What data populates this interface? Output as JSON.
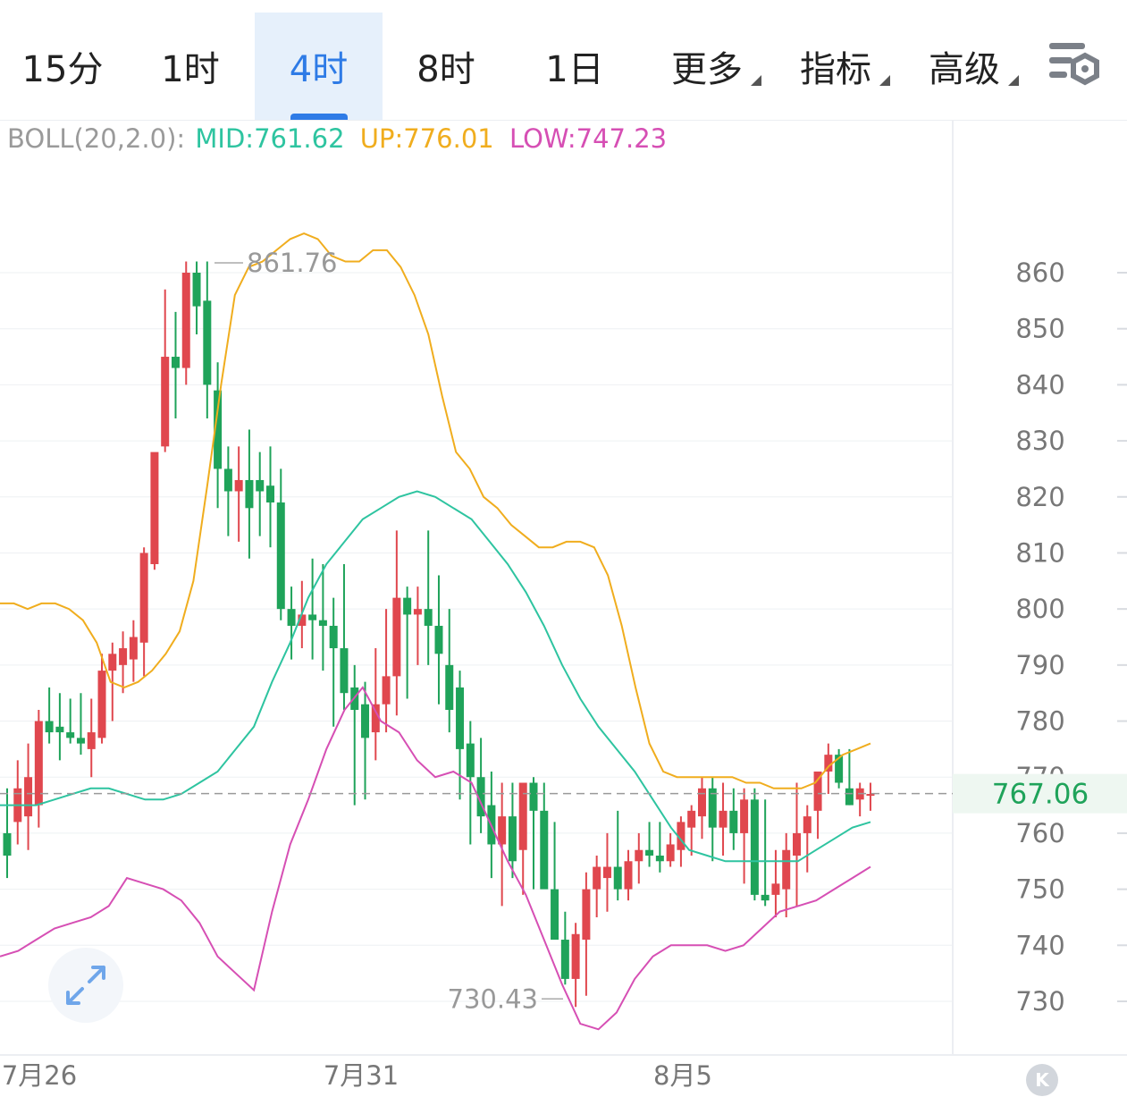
{
  "tabs": [
    {
      "label": "15分",
      "active": false,
      "dropdown": false
    },
    {
      "label": "1时",
      "active": false,
      "dropdown": false
    },
    {
      "label": "4时",
      "active": true,
      "dropdown": false
    },
    {
      "label": "8时",
      "active": false,
      "dropdown": false
    },
    {
      "label": "1日",
      "active": false,
      "dropdown": false
    },
    {
      "label": "更多",
      "active": false,
      "dropdown": true
    },
    {
      "label": "指标",
      "active": false,
      "dropdown": true
    },
    {
      "label": "高级",
      "active": false,
      "dropdown": true
    }
  ],
  "settings_icon": "chart-settings-icon",
  "expand_icon": "expand-arrows-icon",
  "scroll_end_icon": "k-icon",
  "scroll_end_label": "K",
  "indicator": {
    "name": "BOLL(20,2.0):",
    "mid": "MID:761.62",
    "up": "UP:776.01",
    "low": "LOW:747.23",
    "colors": {
      "name": "#9a9a9a",
      "mid": "#2ec4a0",
      "up": "#f0ad1e",
      "low": "#d64fb4"
    }
  },
  "chart_data": {
    "type": "candlestick",
    "interval": "4时",
    "ylim": [
      723,
      875
    ],
    "yticks": [
      730,
      740,
      750,
      760,
      770,
      780,
      790,
      800,
      810,
      820,
      830,
      840,
      850,
      860
    ],
    "ytick_labels": [
      "730",
      "740",
      "750",
      "760",
      "770",
      "780",
      "790",
      "800",
      "810",
      "820",
      "830",
      "840",
      "850",
      "860"
    ],
    "xtick_labels": [
      "7月26",
      "7月31",
      "8月5"
    ],
    "current_price": 767.06,
    "current_price_label": "767.06",
    "high_annotation": {
      "value": 861.76,
      "label": "861.76"
    },
    "low_annotation": {
      "value": 730.43,
      "label": "730.43"
    },
    "colors": {
      "up": "#e0474e",
      "down": "#1fa35a",
      "boll_up": "#f0ad1e",
      "boll_mid": "#2ec4a0",
      "boll_low": "#d64fb4",
      "grid": "#eef0f3",
      "axis_text": "#777777",
      "current_price": "#1fa35a"
    },
    "candles": [
      [
        760,
        768,
        752,
        756
      ],
      [
        762,
        773,
        758,
        768
      ],
      [
        763,
        776,
        757,
        770
      ],
      [
        765,
        782,
        761,
        780
      ],
      [
        780,
        786,
        776,
        778
      ],
      [
        779,
        785,
        773,
        778
      ],
      [
        778,
        784,
        776,
        777
      ],
      [
        777,
        785,
        774,
        776
      ],
      [
        775,
        784,
        770,
        778
      ],
      [
        777,
        792,
        776,
        789
      ],
      [
        789,
        794,
        780,
        792
      ],
      [
        790,
        796,
        785,
        793
      ],
      [
        791,
        798,
        787,
        795
      ],
      [
        794,
        811,
        788,
        810
      ],
      [
        808,
        826,
        807,
        828
      ],
      [
        829,
        857,
        828,
        845
      ],
      [
        845,
        853,
        834,
        843
      ],
      [
        843,
        862,
        840,
        860
      ],
      [
        860,
        862,
        849,
        854
      ],
      [
        855,
        862,
        834,
        840
      ],
      [
        839,
        844,
        818,
        825
      ],
      [
        825,
        829,
        813,
        821
      ],
      [
        821,
        829,
        812,
        823
      ],
      [
        823,
        832,
        809,
        818
      ],
      [
        823,
        828,
        813,
        821
      ],
      [
        822,
        829,
        811,
        819
      ],
      [
        819,
        825,
        798,
        800
      ],
      [
        800,
        804,
        791,
        797
      ],
      [
        797,
        805,
        793,
        799
      ],
      [
        799,
        809,
        791,
        798
      ],
      [
        798,
        808,
        789,
        797
      ],
      [
        797,
        802,
        779,
        793
      ],
      [
        793,
        808,
        782,
        785
      ],
      [
        786,
        790,
        765,
        782
      ],
      [
        783,
        787,
        766,
        777
      ],
      [
        778,
        793,
        773,
        783
      ],
      [
        783,
        800,
        778,
        788
      ],
      [
        788,
        814,
        781,
        802
      ],
      [
        802,
        804,
        784,
        799
      ],
      [
        799,
        804,
        790,
        800
      ],
      [
        800,
        814,
        790,
        797
      ],
      [
        797,
        806,
        783,
        792
      ],
      [
        790,
        800,
        778,
        782
      ],
      [
        786,
        789,
        766,
        775
      ],
      [
        776,
        780,
        758,
        770
      ],
      [
        770,
        777,
        760,
        763
      ],
      [
        765,
        771,
        752,
        758
      ],
      [
        758,
        769,
        747,
        763
      ],
      [
        763,
        769,
        752,
        755
      ],
      [
        757,
        769,
        749,
        769
      ],
      [
        769,
        770,
        750,
        764
      ],
      [
        764,
        769,
        752,
        750
      ],
      [
        750,
        762,
        742,
        741
      ],
      [
        741,
        746,
        733,
        734
      ],
      [
        734,
        744,
        729,
        742
      ],
      [
        741,
        753,
        731,
        750
      ],
      [
        750,
        756,
        745,
        754
      ],
      [
        752,
        760,
        746,
        754
      ],
      [
        754,
        764,
        748,
        750
      ],
      [
        750,
        757,
        748,
        755
      ],
      [
        755,
        760,
        751,
        757
      ],
      [
        757,
        762,
        754,
        756
      ],
      [
        756,
        762,
        753,
        755
      ],
      [
        755,
        760,
        754,
        758
      ],
      [
        757,
        763,
        754,
        762
      ],
      [
        761,
        765,
        756,
        764
      ],
      [
        763,
        770,
        759,
        768
      ],
      [
        768,
        770,
        755,
        761
      ],
      [
        761,
        769,
        756,
        764
      ],
      [
        764,
        768,
        757,
        760
      ],
      [
        760,
        768,
        751,
        766
      ],
      [
        766,
        768,
        748,
        749
      ],
      [
        749,
        766,
        747,
        748
      ],
      [
        749,
        757,
        745,
        751
      ],
      [
        750,
        760,
        745,
        757
      ],
      [
        756,
        769,
        747,
        760
      ],
      [
        760,
        765,
        753,
        763
      ],
      [
        764,
        771,
        759,
        771
      ],
      [
        771,
        776,
        767,
        774
      ],
      [
        774,
        775,
        768,
        769
      ],
      [
        768,
        775,
        765,
        765
      ],
      [
        766,
        769,
        763,
        768
      ],
      [
        767,
        769,
        764,
        767
      ]
    ],
    "boll_up": [
      801,
      801,
      800,
      801,
      801,
      800,
      798,
      794,
      787,
      786,
      787,
      789,
      792,
      796,
      805,
      822,
      840,
      856,
      861,
      862,
      864,
      866,
      867,
      866,
      863,
      862,
      862,
      864,
      864,
      861,
      856,
      849,
      838,
      828,
      825,
      820,
      818,
      815,
      813,
      811,
      811,
      812,
      812,
      811,
      806,
      797,
      786,
      776,
      771,
      770,
      770,
      770,
      770,
      770,
      769,
      769,
      768,
      768,
      768,
      769,
      772,
      774,
      775,
      776
    ],
    "boll_mid": [
      765,
      765,
      765,
      766,
      767,
      768,
      768,
      767,
      766,
      766,
      767,
      769,
      771,
      775,
      779,
      787,
      794,
      802,
      808,
      812,
      816,
      818,
      820,
      821,
      820,
      818,
      816,
      812,
      808,
      803,
      797,
      790,
      784,
      779,
      775,
      771,
      766,
      761,
      757,
      756,
      755,
      755,
      755,
      755,
      755,
      757,
      759,
      761,
      762
    ],
    "boll_low": [
      738,
      739,
      741,
      743,
      744,
      745,
      747,
      752,
      751,
      750,
      748,
      744,
      738,
      735,
      732,
      746,
      758,
      766,
      775,
      782,
      786,
      780,
      778,
      773,
      770,
      771,
      769,
      762,
      755,
      749,
      741,
      733,
      726,
      725,
      728,
      734,
      738,
      740,
      740,
      740,
      739,
      740,
      743,
      746,
      747,
      748,
      750,
      752,
      754
    ]
  }
}
